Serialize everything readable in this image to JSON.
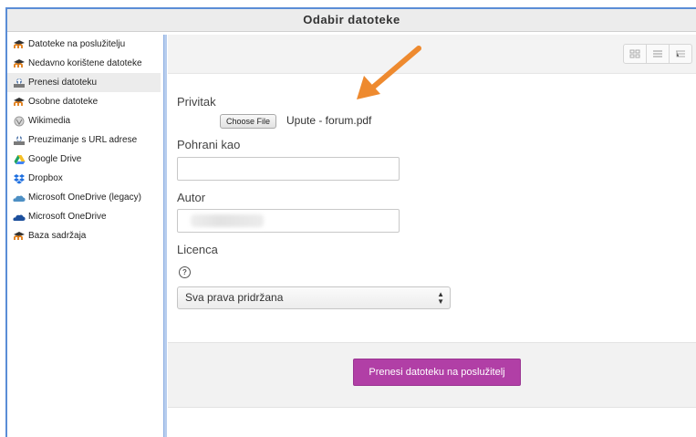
{
  "dialog": {
    "title": "Odabir datoteke"
  },
  "sidebar": {
    "items": [
      {
        "label": "Datoteke na poslužitelju",
        "icon": "moodle-icon"
      },
      {
        "label": "Nedavno korištene datoteke",
        "icon": "moodle-icon"
      },
      {
        "label": "Prenesi datoteku",
        "icon": "upload-icon"
      },
      {
        "label": "Osobne datoteke",
        "icon": "moodle-icon"
      },
      {
        "label": "Wikimedia",
        "icon": "wikimedia-icon"
      },
      {
        "label": "Preuzimanje s URL adrese",
        "icon": "url-download-icon"
      },
      {
        "label": "Google Drive",
        "icon": "google-drive-icon"
      },
      {
        "label": "Dropbox",
        "icon": "dropbox-icon"
      },
      {
        "label": "Microsoft OneDrive (legacy)",
        "icon": "onedrive-legacy-icon"
      },
      {
        "label": "Microsoft OneDrive",
        "icon": "onedrive-icon"
      },
      {
        "label": "Baza sadržaja",
        "icon": "moodle-icon"
      }
    ]
  },
  "form": {
    "attachment_label": "Privitak",
    "choose_file_label": "Choose File",
    "file_name": "Upute - forum.pdf",
    "save_as_label": "Pohrani kao",
    "save_as_value": "",
    "author_label": "Autor",
    "license_label": "Licenca",
    "license_selected": "Sva prava pridržana",
    "upload_button": "Prenesi datoteku na poslužitelj"
  },
  "colors": {
    "accent_border": "#5a8dd6",
    "upload_button": "#b13fa6",
    "annotation_arrow": "#ee8a2f"
  }
}
